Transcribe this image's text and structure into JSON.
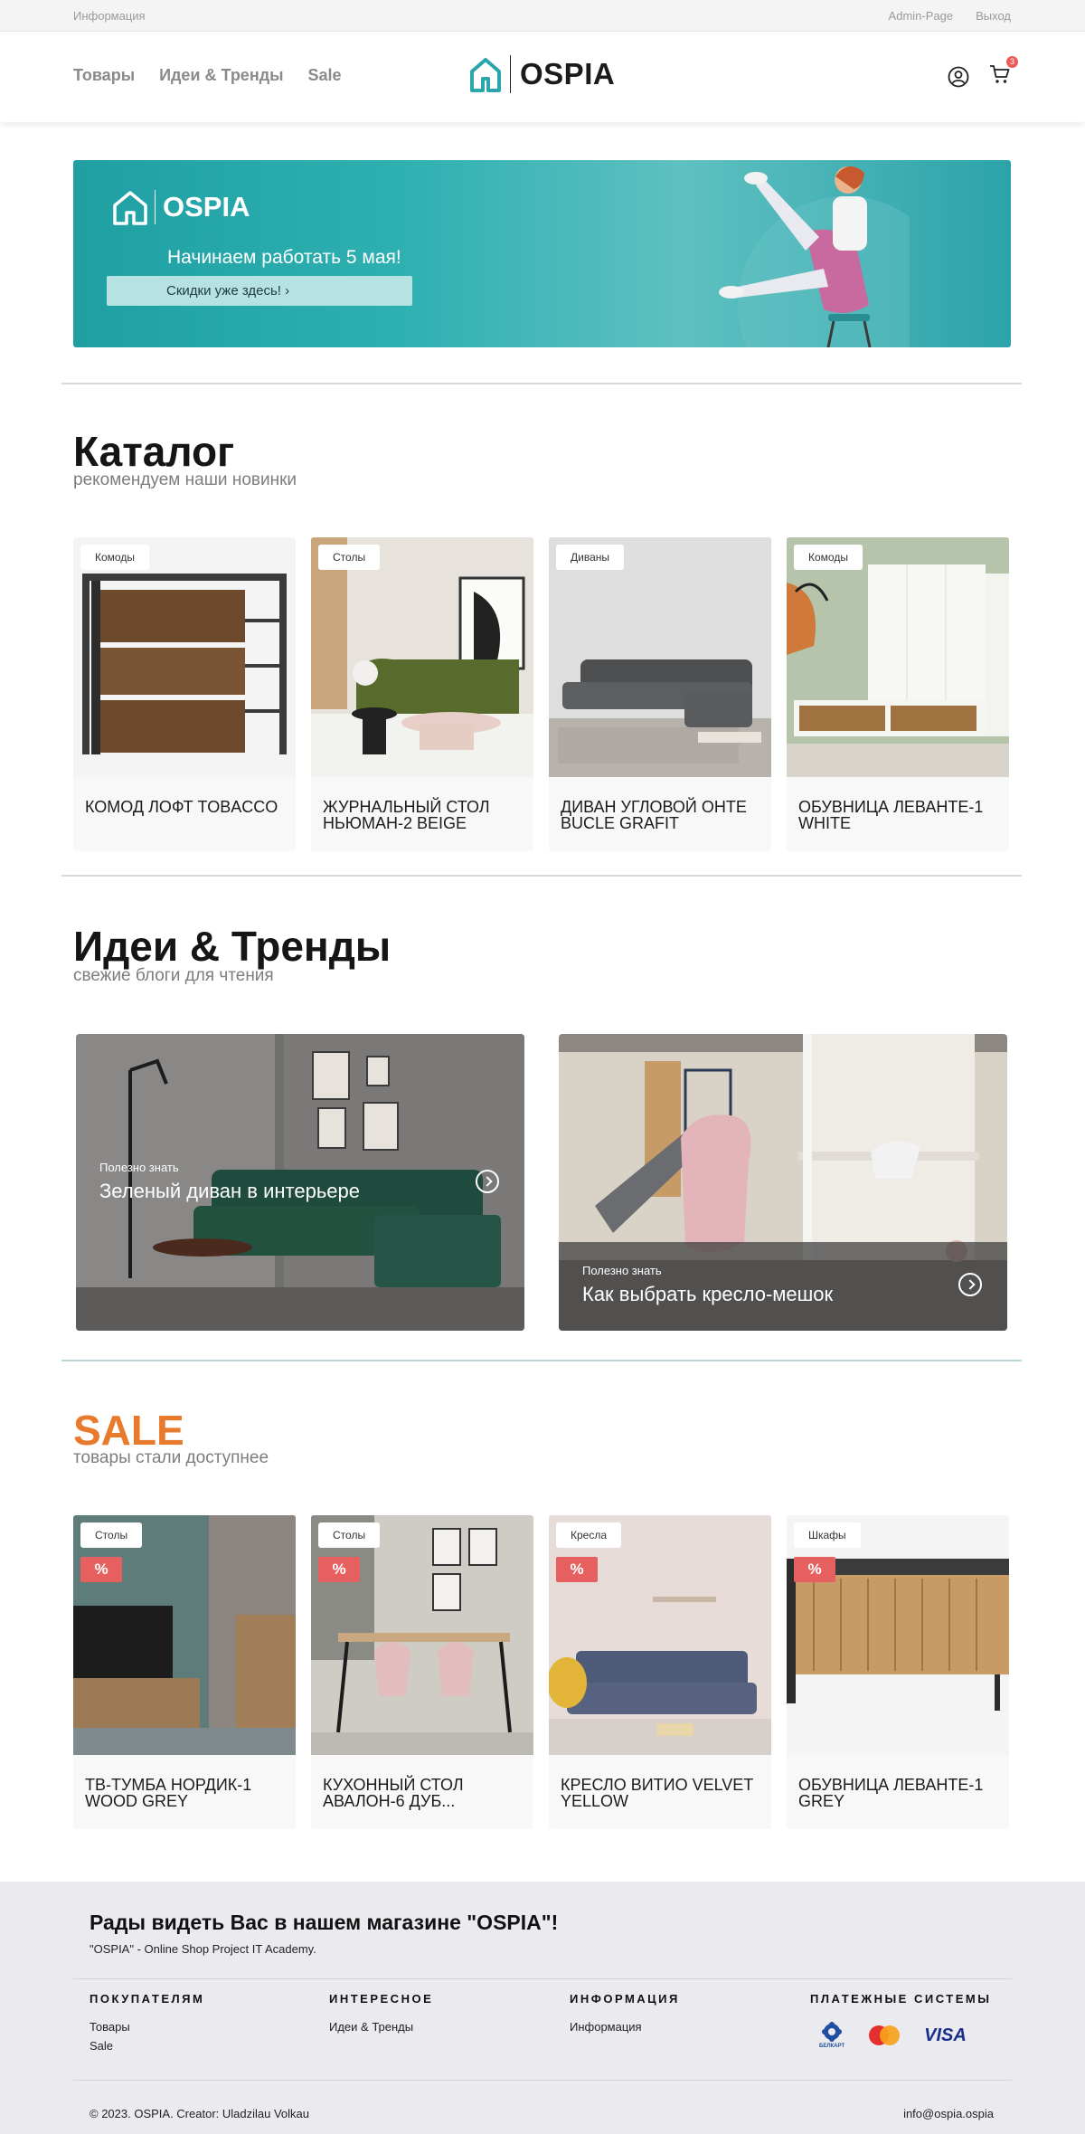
{
  "topbar": {
    "info": "Информация",
    "admin": "Admin-Page",
    "logout": "Выход"
  },
  "header": {
    "nav": [
      "Товары",
      "Идеи & Тренды",
      "Sale"
    ],
    "logo_text": "OSPIA",
    "cart_count": "3"
  },
  "banner": {
    "logo_text": "OSPIA",
    "title": "Начинаем работать 5 мая!",
    "button": "Скидки уже здесь!  ›"
  },
  "catalog": {
    "title": "Каталог",
    "subtitle": "рекомендуем наши новинки",
    "items": [
      {
        "tag": "Комоды",
        "name": "КОМОД ЛОФТ TOBACCO"
      },
      {
        "tag": "Столы",
        "name": "ЖУРНАЛЬНЫЙ СТОЛ НЬЮМАН-2 BEIGE"
      },
      {
        "tag": "Диваны",
        "name": "ДИВАН УГЛОВОЙ ОНТЕ BUCLE GRAFIT"
      },
      {
        "tag": "Комоды",
        "name": "ОБУВНИЦА ЛЕВАНТЕ-1 WHITE"
      }
    ]
  },
  "ideas": {
    "title": "Идеи & Тренды",
    "subtitle": "свежие блоги для чтения",
    "posts": [
      {
        "label": "Полезно знать",
        "title": "Зеленый диван в интерьере"
      },
      {
        "label": "Полезно знать",
        "title": "Как выбрать кресло-мешок"
      }
    ]
  },
  "sale": {
    "title": "SALE",
    "subtitle": "товары стали доступнее",
    "badge": "%",
    "items": [
      {
        "tag": "Столы",
        "name": "ТВ-ТУМБА НОРДИК-1 WOOD GREY"
      },
      {
        "tag": "Столы",
        "name": "КУХОННЫЙ СТОЛ АВАЛОН-6 ДУБ..."
      },
      {
        "tag": "Кресла",
        "name": "КРЕСЛО ВИТИО VELVET YELLOW"
      },
      {
        "tag": "Шкафы",
        "name": "ОБУВНИЦА ЛЕВАНТЕ-1 GREY"
      }
    ]
  },
  "footer": {
    "welcome": "Рады видеть Вас в нашем магазине \"OSPIA\"!",
    "sub": "\"OSPIA\" - Online Shop Project IT Academy.",
    "cols": [
      {
        "heading": "ПОКУПАТЕЛЯМ",
        "links": [
          "Товары",
          "Sale"
        ]
      },
      {
        "heading": "ИНТЕРЕСНОЕ",
        "links": [
          "Идеи & Тренды"
        ]
      },
      {
        "heading": "ИНФОРМАЦИЯ",
        "links": [
          "Информация"
        ]
      },
      {
        "heading": "ПЛАТЕЖНЫЕ СИСТЕМЫ",
        "links": []
      }
    ],
    "pay": {
      "belkart": "БЕЛКАРТ",
      "visa": "VISA"
    },
    "copyright": "© 2023. OSPIA. Creator: Uladzilau Volkau",
    "email": "info@ospia.ospia"
  },
  "colors": {
    "accent_teal": "#2aa7ab",
    "sale_orange": "#e87a2d",
    "badge_red": "#e66060"
  }
}
